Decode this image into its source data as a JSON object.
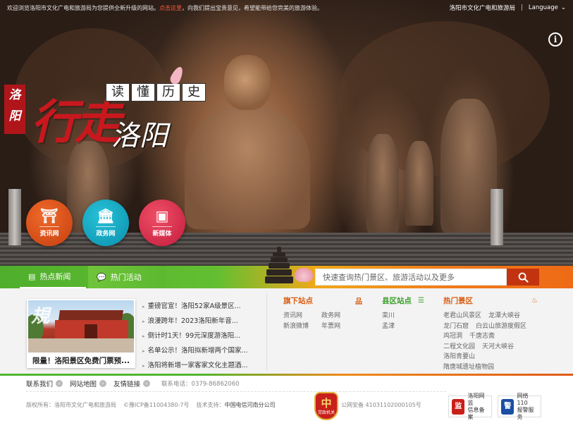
{
  "topbar": {
    "notice_prefix": "欢迎浏览洛阳市文化广电和旅游局为您提供全新升级的网站。",
    "notice_link": "点击这里",
    "notice_suffix": "，向我们提出宝贵意见，希望能带给您完美的旅游体验。",
    "site_name": "洛阳市文化广电和旅游局",
    "language": "Language"
  },
  "hero": {
    "region_label": "洛阳",
    "slogan_big": "行走",
    "slogan_city": "洛阳",
    "tagline": [
      "读",
      "懂",
      "历",
      "史"
    ],
    "circles": [
      {
        "label": "资讯网",
        "icon": "⛩"
      },
      {
        "label": "政务网",
        "icon": "🏛"
      },
      {
        "label": "新媒体",
        "icon": "▣"
      }
    ]
  },
  "nav": {
    "tabs": [
      "热点新闻",
      "热门活动"
    ],
    "search_placeholder": "快速查询热门景区、旅游活动以及更多"
  },
  "news": {
    "feature_caption": "限量！洛阳景区免费门票预...",
    "stamp": "規",
    "items": [
      "重磅官宣！洛阳52家A级景区...",
      "浪漫跨年！2023洛阳新年音...",
      "倒计时1天！99元深度游洛阳...",
      "名单公示！洛阳拟新增两个国家...",
      "洛阳将新增一家客家文化主题酒..."
    ]
  },
  "panels": {
    "sub_sites": {
      "title": "旗下站点",
      "links": [
        "资讯网",
        "政务网",
        "新浪微博",
        "年票网"
      ]
    },
    "county_sites": {
      "title": "县区站点",
      "links": [
        "栾川",
        "孟津"
      ]
    },
    "hot_spots": {
      "title": "热门景区",
      "links": [
        "老君山风景区",
        "龙潭大峡谷",
        "龙门石窟",
        "白云山旅游度假区",
        "鸡冠洞",
        "千唐志斋",
        "二程文化园",
        "天河大峡谷",
        "洛阳青要山",
        "隋唐城遗址植物园"
      ]
    }
  },
  "footer": {
    "links": [
      "联系我们",
      "网站地图",
      "友情链接"
    ],
    "phone": "联系电话：0379-86862060",
    "copyright": "版权所有：洛阳市文化广电和旅游局",
    "icp": "©豫ICP备11004380-7号",
    "tech": "技术支持：",
    "tech_org": "中国电信河南分公司",
    "police": "公网安备 41031102000105号",
    "gov_badge_char": "中",
    "gov_badge_text": "党政机关",
    "badge1": {
      "line1": "洛阳网监",
      "line2": "信息备案",
      "icon": "监"
    },
    "badge2": {
      "line1": "网络110",
      "line2": "报警服务",
      "icon": "警"
    }
  }
}
